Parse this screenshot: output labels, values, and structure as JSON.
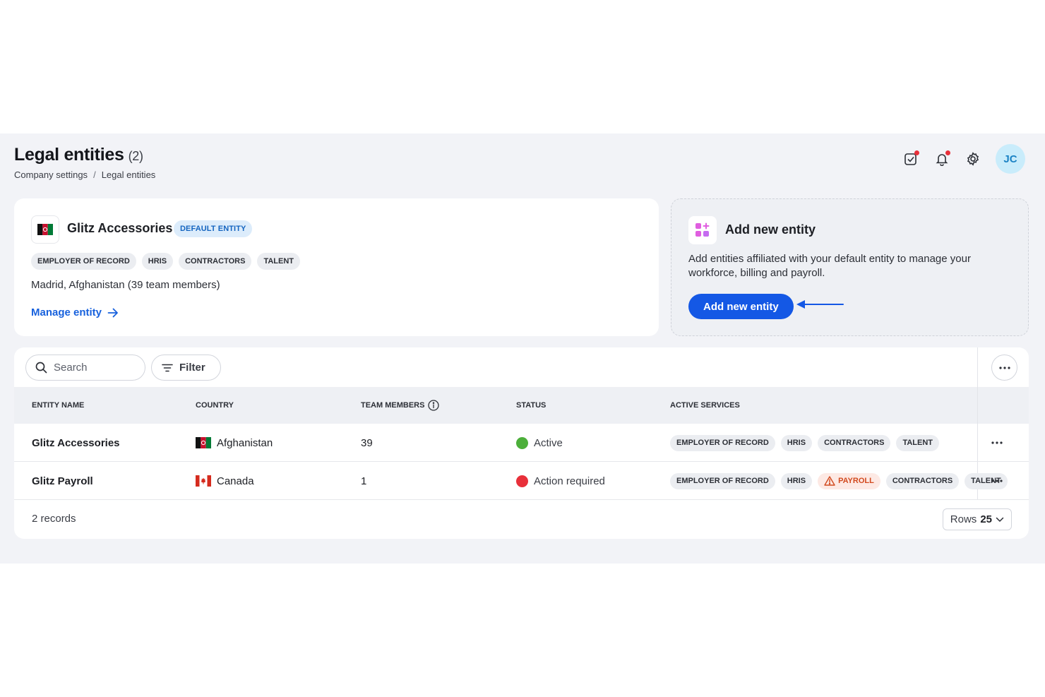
{
  "header": {
    "title": "Legal entities",
    "count": "(2)",
    "breadcrumb": [
      "Company settings",
      "/",
      "Legal entities"
    ],
    "avatar_initials": "JC"
  },
  "icons": {
    "tasks": "checkbox-icon",
    "notifications": "bell-icon",
    "settings": "gear-icon"
  },
  "default_entity": {
    "name": "Glitz Accessories",
    "badge": "DEFAULT ENTITY",
    "services": [
      "EMPLOYER OF RECORD",
      "HRIS",
      "CONTRACTORS",
      "TALENT"
    ],
    "location": "Madrid, Afghanistan (39 team members)",
    "manage_link": "Manage entity"
  },
  "add_entity": {
    "title": "Add new entity",
    "description": "Add entities affiliated with your default entity to manage your workforce, billing and payroll.",
    "button": "Add new entity"
  },
  "toolbar": {
    "search_placeholder": "Search",
    "filter_label": "Filter"
  },
  "table": {
    "columns": [
      "ENTITY NAME",
      "COUNTRY",
      "TEAM MEMBERS",
      "STATUS",
      "ACTIVE SERVICES"
    ],
    "rows": [
      {
        "name": "Glitz Accessories",
        "country": "Afghanistan",
        "team_members": "39",
        "status": "Active",
        "status_color": "#4caf3a",
        "services": [
          "EMPLOYER OF RECORD",
          "HRIS",
          "CONTRACTORS",
          "TALENT"
        ]
      },
      {
        "name": "Glitz Payroll",
        "country": "Canada",
        "team_members": "1",
        "status": "Action required",
        "status_color": "#e8303a",
        "services": [
          "EMPLOYER OF RECORD",
          "HRIS",
          "PAYROLL",
          "CONTRACTORS",
          "TALENT"
        ]
      }
    ],
    "records": "2 records",
    "rows_label": "Rows",
    "rows_value": "25"
  },
  "colors": {
    "primary": "#1458e5",
    "link": "#1761dd",
    "badge_bg": "#dcecfb",
    "warning": "#d24a1f"
  }
}
